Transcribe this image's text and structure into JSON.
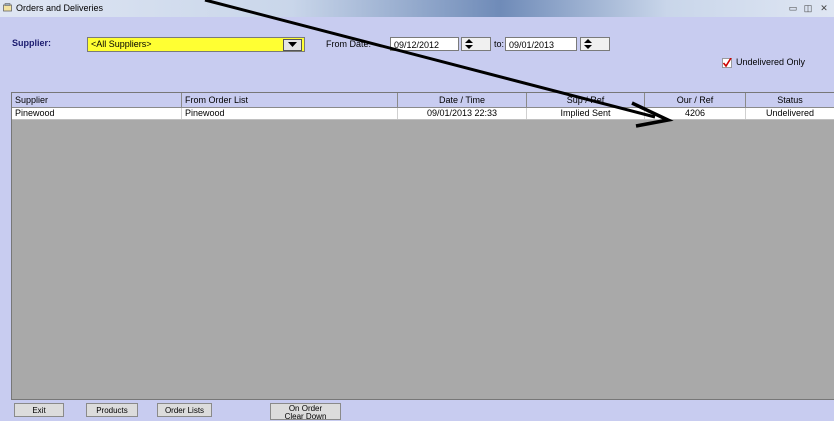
{
  "window": {
    "title": "Orders and Deliveries",
    "controls": [
      "minimize",
      "maximize",
      "close"
    ]
  },
  "filters": {
    "supplier_label": "Supplier:",
    "supplier_value": "<All Suppliers>",
    "from_date_label": "From Date:",
    "from_date": "09/12/2012",
    "to_label": "to:",
    "to_date": "09/01/2013",
    "undelivered_only_label": "Undelivered Only",
    "undelivered_only_checked": true
  },
  "table": {
    "columns": [
      "Supplier",
      "From Order List",
      "Date / Time",
      "Sup / Ref",
      "Our / Ref",
      "Status"
    ],
    "rows": [
      [
        "Pinewood",
        "Pinewood",
        "09/01/2013 22:33",
        "Implied Sent",
        "4206",
        "Undelivered"
      ]
    ]
  },
  "buttons": {
    "exit": "Exit",
    "products": "Products",
    "order_lists": "Order Lists",
    "on_order_line1": "On Order",
    "on_order_line2": "Clear Down"
  },
  "colors": {
    "panel_bg": "#c8ccf0",
    "grid_bg": "#a9a9a9",
    "supplier_highlight": "#ffff33",
    "checkbox_tick": "#cc0000",
    "annotation_arrow": "#000000"
  }
}
